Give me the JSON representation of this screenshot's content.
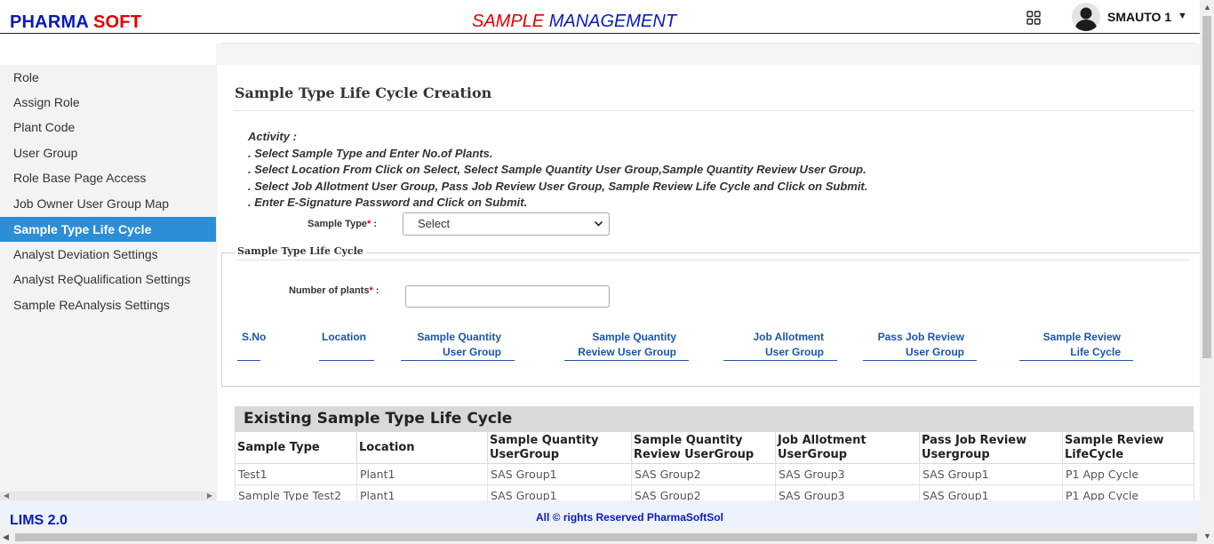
{
  "header": {
    "brand_part1": "PHARMA",
    "brand_part2": "SOFT",
    "title_part1": "SAMPLE",
    "title_part2": "MANAGEMENT",
    "username": "SMAUTO 1",
    "apps_icon": "grid-icon",
    "user_menu_icon": "caret-down-icon"
  },
  "sidebar": {
    "items": [
      {
        "label": "Role"
      },
      {
        "label": "Assign Role"
      },
      {
        "label": "Plant Code"
      },
      {
        "label": "User Group"
      },
      {
        "label": "Role Base Page Access"
      },
      {
        "label": "Job Owner User Group Map"
      },
      {
        "label": "Sample Type Life Cycle",
        "active": true
      },
      {
        "label": "Analyst Deviation Settings"
      },
      {
        "label": "Analyst ReQualification Settings"
      },
      {
        "label": "Sample ReAnalysis Settings"
      }
    ]
  },
  "page": {
    "title": "Sample Type Life Cycle Creation",
    "activity": [
      "Activity :",
      ". Select Sample Type and Enter No.of Plants.",
      ". Select Location From Click on Select, Select Sample Quantity User Group,Sample Quantity Review User Group.",
      ". Select Job Allotment User Group, Pass Job Review User Group, Sample Review Life Cycle and Click on Submit.",
      ". Enter E-Signature Password and Click on Submit."
    ],
    "sample_type_label": "Sample Type",
    "sample_type_value": "Select",
    "required_mark": "*",
    "colon": " :",
    "lifecycle_legend": "Sample Type Life Cycle",
    "plants_label": "Number of plants",
    "plants_value": "",
    "lifecycle_headers": [
      {
        "l1": "S.No",
        "l2": ""
      },
      {
        "l1": "Location",
        "l2": ""
      },
      {
        "l1": "Sample Quantity",
        "l2": "User Group"
      },
      {
        "l1": "Sample Quantity",
        "l2": "Review User Group"
      },
      {
        "l1": "Job Allotment",
        "l2": "User Group"
      },
      {
        "l1": "Pass Job Review",
        "l2": "User Group"
      },
      {
        "l1": "Sample Review",
        "l2": "Life Cycle"
      }
    ]
  },
  "existing": {
    "title": "Existing Sample Type Life Cycle",
    "columns": [
      {
        "l1": "Sample Type",
        "l2": ""
      },
      {
        "l1": "Location",
        "l2": ""
      },
      {
        "l1": "Sample Quantity",
        "l2": "UserGroup"
      },
      {
        "l1": "Sample Quantity",
        "l2": "Review UserGroup"
      },
      {
        "l1": "Job Allotment",
        "l2": "UserGroup"
      },
      {
        "l1": "Pass Job Review",
        "l2": "Usergroup"
      },
      {
        "l1": "Sample Review",
        "l2": "LifeCycle"
      }
    ],
    "rows": [
      [
        "Test1",
        "Plant1",
        "SAS Group1",
        "SAS Group2",
        "SAS Group3",
        "SAS Group1",
        "P1 App Cycle"
      ],
      [
        "Sample Type Test2",
        "Plant1",
        "SAS Group1",
        "SAS Group2",
        "SAS Group3",
        "SAS Group1",
        "P1 App Cycle"
      ]
    ]
  },
  "footer": {
    "version": "LIMS 2.0",
    "copyright": "All © rights Reserved PharmaSoftSol"
  }
}
